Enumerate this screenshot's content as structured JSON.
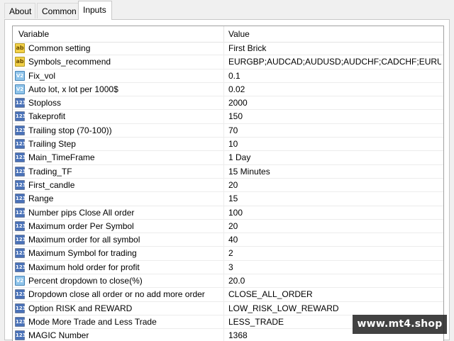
{
  "tabs": [
    {
      "label": "About",
      "active": false
    },
    {
      "label": "Common",
      "active": false
    },
    {
      "label": "Inputs",
      "active": true
    }
  ],
  "table": {
    "headers": {
      "variable": "Variable",
      "value": "Value"
    },
    "rows": [
      {
        "icon": "ab",
        "name": "Common setting",
        "value": "First Brick"
      },
      {
        "icon": "ab",
        "name": "Symbols_recommend",
        "value": "EURGBP;AUDCAD;AUDUSD;AUDCHF;CADCHF;EURUS..."
      },
      {
        "icon": "v2",
        "name": "Fix_vol",
        "value": "0.1"
      },
      {
        "icon": "v2",
        "name": "Auto lot, x lot per 1000$",
        "value": "0.02"
      },
      {
        "icon": "123",
        "name": "Stoploss",
        "value": "2000"
      },
      {
        "icon": "123",
        "name": "Takeprofit",
        "value": "150"
      },
      {
        "icon": "123",
        "name": "Trailing stop (70-100))",
        "value": "70"
      },
      {
        "icon": "123",
        "name": "Trailing Step",
        "value": "10"
      },
      {
        "icon": "123",
        "name": "Main_TimeFrame",
        "value": "1 Day"
      },
      {
        "icon": "123",
        "name": "Trading_TF",
        "value": "15 Minutes"
      },
      {
        "icon": "123",
        "name": "First_candle",
        "value": "20"
      },
      {
        "icon": "123",
        "name": "Range",
        "value": "15"
      },
      {
        "icon": "123",
        "name": "Number pips Close All order",
        "value": "100"
      },
      {
        "icon": "123",
        "name": "Maximum order Per Symbol",
        "value": "20"
      },
      {
        "icon": "123",
        "name": "Maximum order for all symbol",
        "value": "40"
      },
      {
        "icon": "123",
        "name": "Maximum Symbol for trading",
        "value": "2"
      },
      {
        "icon": "123",
        "name": "Maximum hold order for profit",
        "value": "3"
      },
      {
        "icon": "v2",
        "name": "Percent dropdown to close(%)",
        "value": "20.0"
      },
      {
        "icon": "123",
        "name": "Dropdown close all order or no add more order",
        "value": "CLOSE_ALL_ORDER"
      },
      {
        "icon": "123",
        "name": "Option RISK and REWARD",
        "value": "LOW_RISK_LOW_REWARD"
      },
      {
        "icon": "123",
        "name": "Mode More Trade and Less Trade",
        "value": "LESS_TRADE"
      },
      {
        "icon": "123",
        "name": "MAGIC Number",
        "value": "1368"
      }
    ]
  },
  "icon_labels": {
    "ab": "ab",
    "v2": "V2",
    "123": "123"
  },
  "watermark": "www.mt4.shop"
}
